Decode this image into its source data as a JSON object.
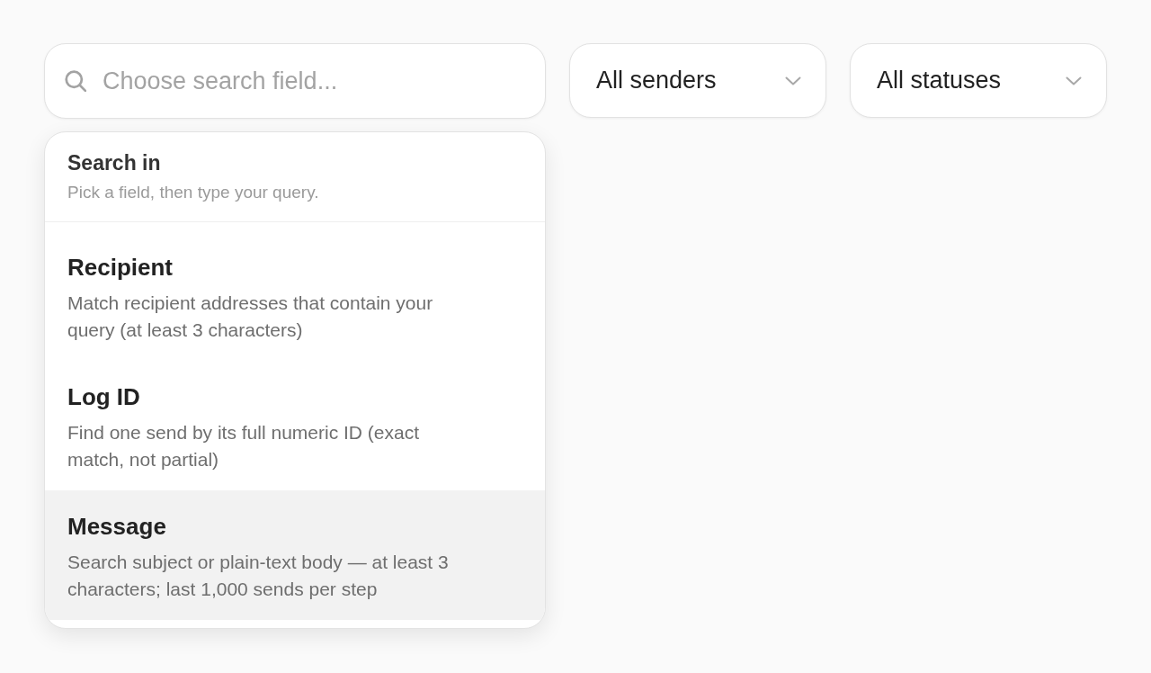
{
  "search": {
    "placeholder": "Choose search field..."
  },
  "filters": [
    {
      "value": "All senders"
    },
    {
      "value": "All statuses"
    }
  ],
  "dropdown": {
    "title": "Search in",
    "subtitle": "Pick a field, then type your query.",
    "options": [
      {
        "label": "Recipient",
        "description": "Match recipient addresses that contain your query (at least 3 characters)",
        "selected": false
      },
      {
        "label": "Log ID",
        "description": "Find one send by its full numeric ID (exact match, not partial)",
        "selected": false
      },
      {
        "label": "Message",
        "description": "Search subject or plain-text body — at least 3 characters; last 1,000 sends per step",
        "selected": true
      }
    ]
  }
}
